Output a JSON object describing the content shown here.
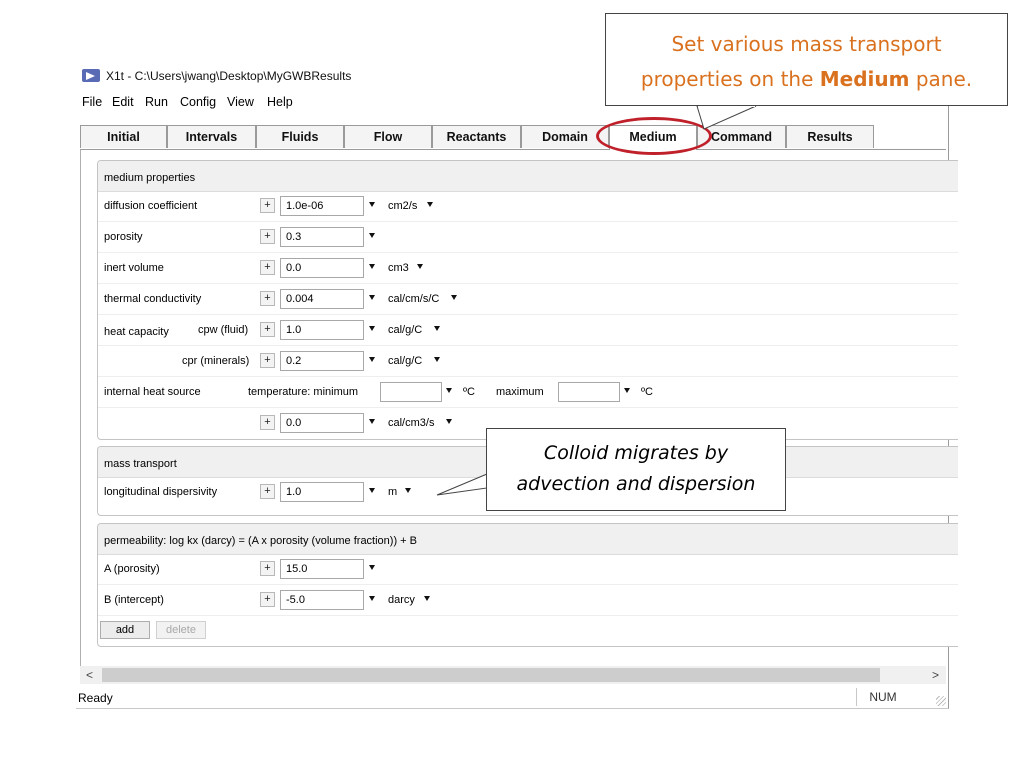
{
  "window": {
    "title": "X1t - C:\\Users\\jwang\\Desktop\\MyGWBResults"
  },
  "menu": [
    "File",
    "Edit",
    "Run",
    "Config",
    "View",
    "Help"
  ],
  "tabs": [
    "Initial",
    "Intervals",
    "Fluids",
    "Flow",
    "Reactants",
    "Domain",
    "Medium",
    "Command",
    "Results"
  ],
  "active_tab": "Medium",
  "medium_properties": {
    "title": "medium properties",
    "diffusion_label": "diffusion coefficient",
    "diffusion_value": "1.0e-06",
    "diffusion_unit": "cm2/s",
    "porosity_label": "porosity",
    "porosity_value": "0.3",
    "inert_label": "inert volume",
    "inert_value": "0.0",
    "inert_unit": "cm3",
    "thermal_label": "thermal conductivity",
    "thermal_value": "0.004",
    "thermal_unit": "cal/cm/s/C",
    "heat_label": "heat capacity",
    "cpw_label": "cpw (fluid)",
    "cpw_value": "1.0",
    "cpw_unit": "cal/g/C",
    "cpr_label": "cpr (minerals)",
    "cpr_value": "0.2",
    "cpr_unit": "cal/g/C",
    "heat_source_label": "internal heat source",
    "temperature_label": "temperature:  minimum",
    "min_value": "",
    "min_unit": "ºC",
    "maximum_label": "maximum",
    "max_value": "",
    "max_unit": "ºC",
    "source_value": "0.0",
    "source_unit": "cal/cm3/s"
  },
  "mass_transport": {
    "title": "mass transport",
    "disp_label": "longitudinal dispersivity",
    "disp_value": "1.0",
    "disp_unit": "m"
  },
  "permeability": {
    "title": "permeability: log kx (darcy) = (A x porosity (volume fraction)) + B",
    "a_label": "A (porosity)",
    "a_value": "15.0",
    "b_label": "B (intercept)",
    "b_value": "-5.0",
    "b_unit": "darcy",
    "add_label": "add",
    "delete_label": "delete"
  },
  "scroll": {
    "left": "<",
    "right": ">"
  },
  "status": {
    "ready": "Ready",
    "num": "NUM"
  },
  "callouts": {
    "top_line1": "Set various mass transport",
    "top_line2_prefix": "properties on the ",
    "top_line2_bold": "Medium",
    "top_line2_suffix": " pane.",
    "mid_line1": "Colloid migrates by",
    "mid_line2": "advection and dispersion"
  },
  "colors": {
    "callout_text": "#d9711f",
    "highlight_ring": "#c0202a"
  }
}
